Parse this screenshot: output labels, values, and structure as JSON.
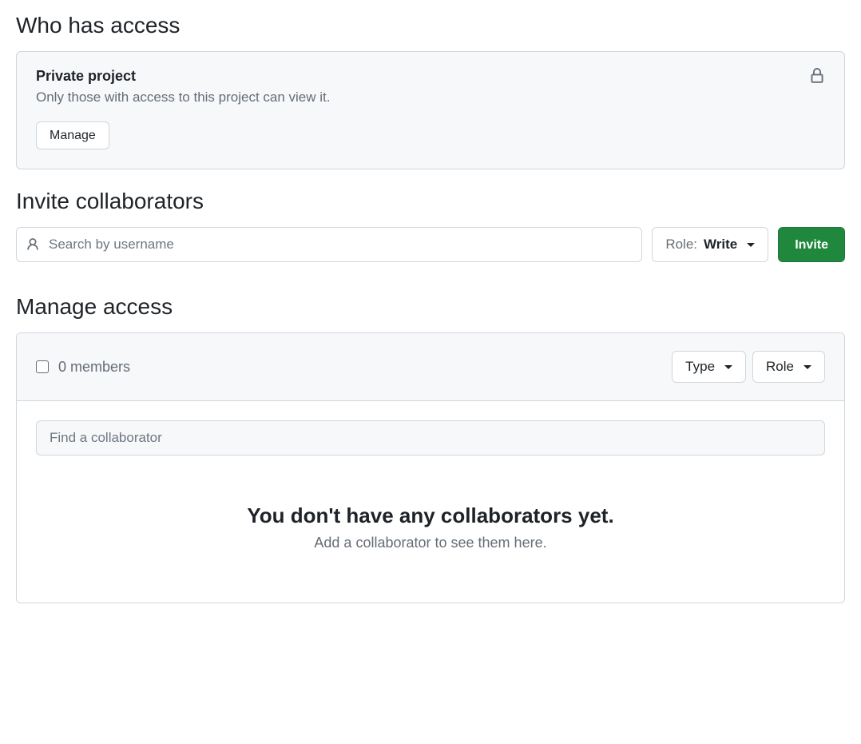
{
  "access": {
    "heading": "Who has access",
    "card": {
      "title": "Private project",
      "description": "Only those with access to this project can view it.",
      "manage_label": "Manage"
    }
  },
  "invite": {
    "heading": "Invite collaborators",
    "search_placeholder": "Search by username",
    "role_prefix": "Role: ",
    "role_value": "Write",
    "invite_label": "Invite"
  },
  "manage": {
    "heading": "Manage access",
    "members_label": "0 members",
    "type_label": "Type",
    "role_label": "Role",
    "find_placeholder": "Find a collaborator",
    "empty_title": "You don't have any collaborators yet.",
    "empty_sub": "Add a collaborator to see them here."
  }
}
